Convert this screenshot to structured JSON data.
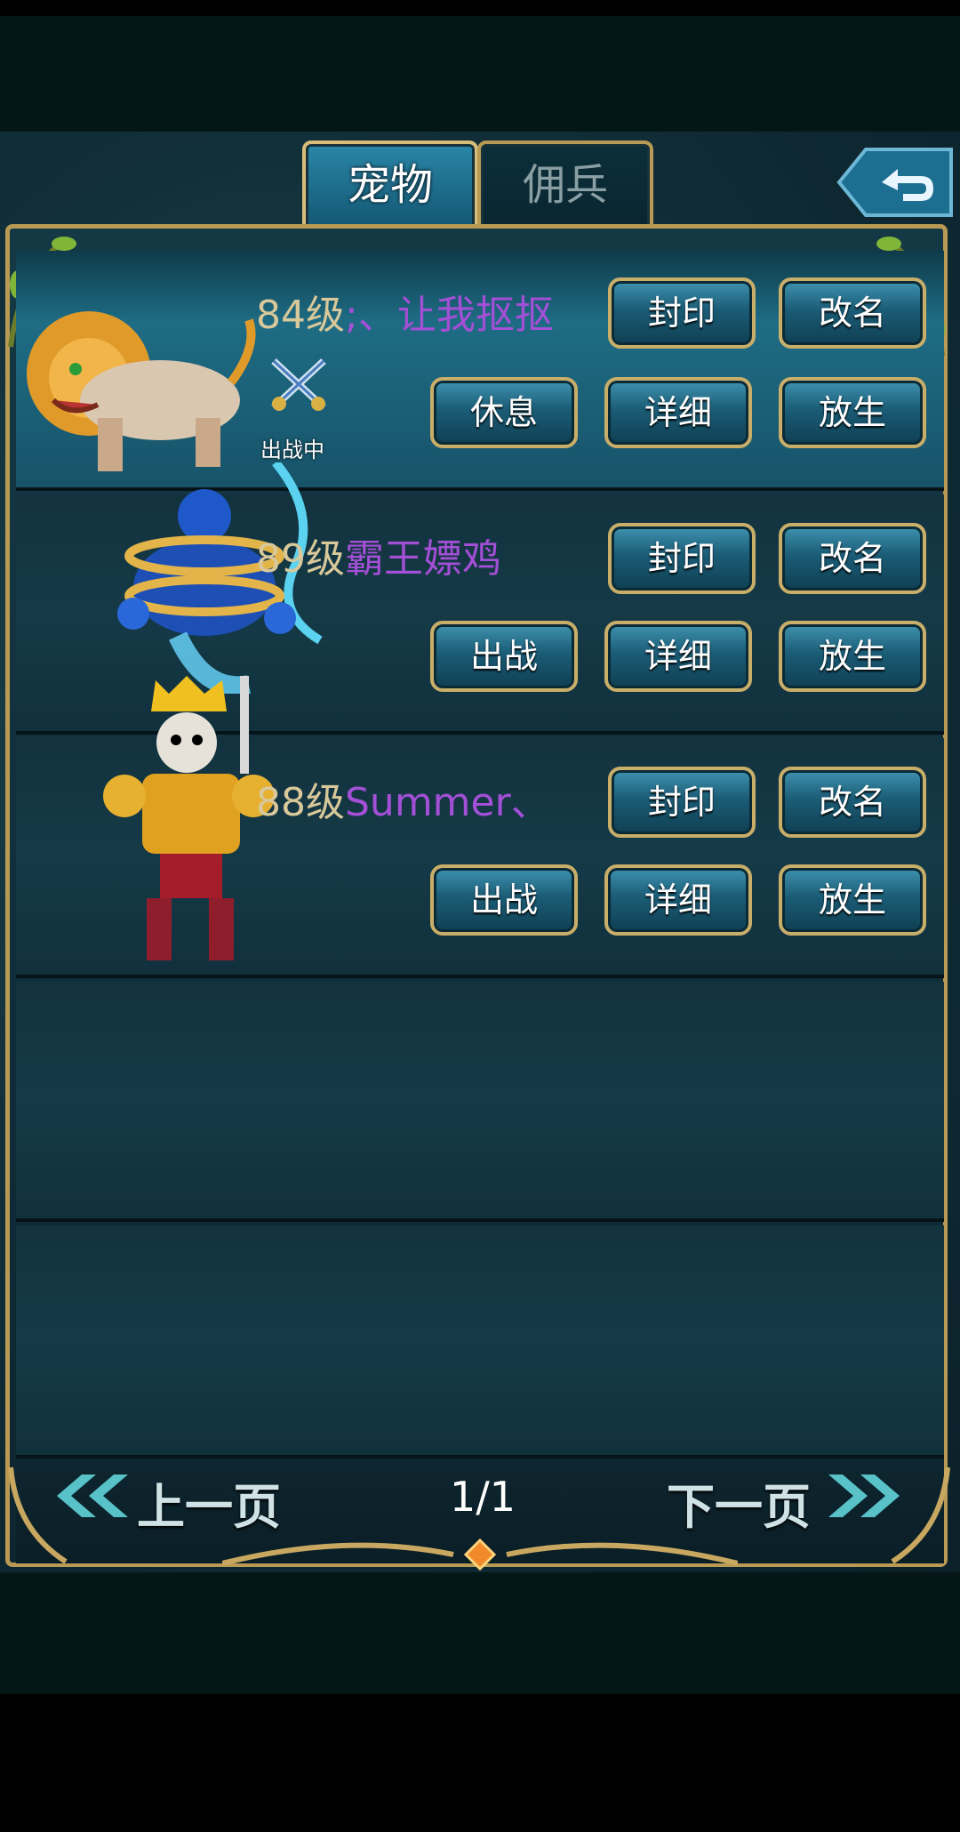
{
  "tabs": [
    {
      "label": "宠物",
      "active": true
    },
    {
      "label": "佣兵",
      "active": false
    }
  ],
  "pets": [
    {
      "level": "84级",
      "name": ";、让我抠抠",
      "status": "出战中",
      "actions": {
        "seal": "封印",
        "rename": "改名",
        "toggle": "休息",
        "detail": "详细",
        "release": "放生"
      }
    },
    {
      "level": "89级",
      "name": "霸王嫖鸡",
      "actions": {
        "seal": "封印",
        "rename": "改名",
        "toggle": "出战",
        "detail": "详细",
        "release": "放生"
      }
    },
    {
      "level": "88级",
      "name": "Summer、",
      "actions": {
        "seal": "封印",
        "rename": "改名",
        "toggle": "出战",
        "detail": "详细",
        "release": "放生"
      }
    }
  ],
  "pager": {
    "prev": "上一页",
    "page": "1/1",
    "next": "下一页"
  },
  "icons": {
    "back": "back-arrow-icon",
    "active_pet": "crossed-swords-icon"
  },
  "colors": {
    "accent": "#a34fd6",
    "frame": "#b89a55",
    "button": "#1b5c76"
  }
}
